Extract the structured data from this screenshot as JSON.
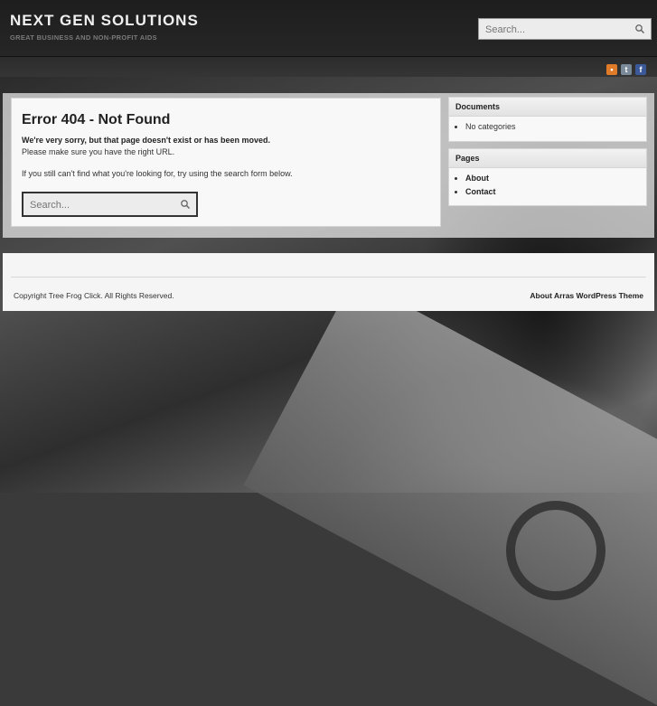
{
  "header": {
    "title": "NEXT GEN SOLUTIONS",
    "tagline": "GREAT BUSINESS AND NON-PROFIT AIDS",
    "search_placeholder": "Search..."
  },
  "social": {
    "icons": [
      "rss-icon",
      "twitter-icon",
      "facebook-icon"
    ]
  },
  "content": {
    "title": "Error 404 - Not Found",
    "bold_text": "We're very sorry, but that page doesn't exist or has been moved.",
    "text1": "Please make sure you have the right URL.",
    "text2": "If you still can't find what you're looking for, try using the search form below.",
    "search_placeholder": "Search..."
  },
  "sidebar": {
    "documents": {
      "title": "Documents",
      "items": [
        "No categories"
      ]
    },
    "pages": {
      "title": "Pages",
      "items": [
        "About",
        "Contact"
      ]
    }
  },
  "footer": {
    "copyright": "Copyright Tree Frog Click. All Rights Reserved.",
    "link": "About Arras WordPress Theme"
  },
  "colors": {
    "header_bg": "#1e1e1e",
    "rss": "#e07b2a",
    "facebook": "#3b5998"
  }
}
